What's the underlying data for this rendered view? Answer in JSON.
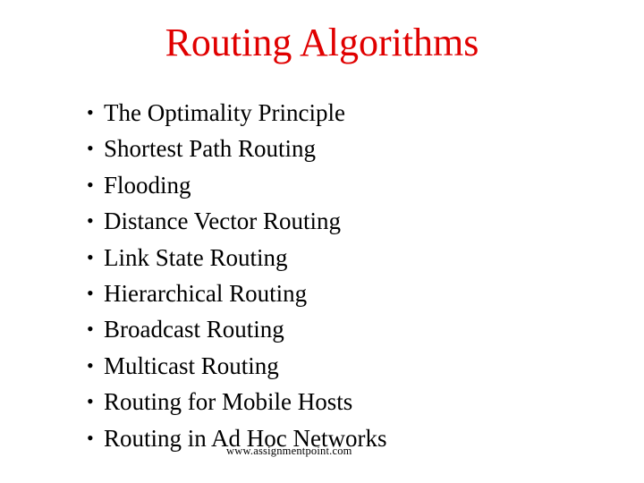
{
  "slide": {
    "title": "Routing Algorithms",
    "title_color": "#e00000",
    "bullet_glyph": "•",
    "items": [
      {
        "label": "The Optimality Principle"
      },
      {
        "label": "Shortest Path Routing"
      },
      {
        "label": "Flooding"
      },
      {
        "label": "Distance Vector Routing"
      },
      {
        "label": "Link State Routing"
      },
      {
        "label": "Hierarchical Routing"
      },
      {
        "label": "Broadcast Routing"
      },
      {
        "label": "Multicast Routing"
      },
      {
        "label": "Routing for Mobile Hosts"
      },
      {
        "label": "Routing in Ad Hoc Networks"
      }
    ],
    "watermark": "www.assignmentpoint.com"
  }
}
